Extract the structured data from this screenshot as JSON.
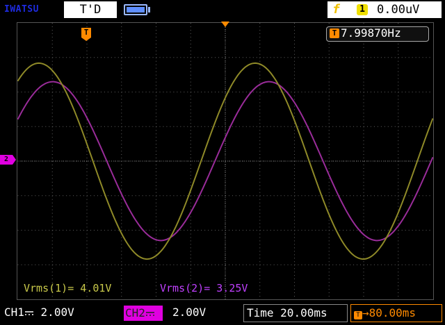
{
  "header": {
    "brand": "IWATSU",
    "mode": "T'D",
    "battery_icon": "battery-icon",
    "trigger_edge_symbol": "f",
    "trigger_source": "1",
    "trigger_level": "0.00uV"
  },
  "screen": {
    "frequency_icon_label": "T",
    "frequency": "7.99870Hz",
    "trigger_marker_label": "T",
    "ch2_marker_label": "2"
  },
  "measurements": {
    "ch1": "Vrms(1)= 4.01V",
    "ch2": "Vrms(2)= 3.25V"
  },
  "footer": {
    "ch1_name": "CH1",
    "ch1_scale": "2.00V",
    "ch2_name": "CH2",
    "ch2_scale": "2.00V",
    "time_label": "Time",
    "time_scale": "20.00ms",
    "delay_icon_label": "T",
    "delay_value": "→80.00ms"
  },
  "traces": {
    "ch1": {
      "color": "#8f8a28",
      "frequency_hz": 7.9987
    },
    "ch2": {
      "color": "#9a2c9a",
      "frequency_hz": 7.9987
    }
  },
  "colors": {
    "ch1": "#c9c94a",
    "ch2": "#e000e0",
    "trigger": "#ff8a00",
    "grid": "#606060"
  }
}
